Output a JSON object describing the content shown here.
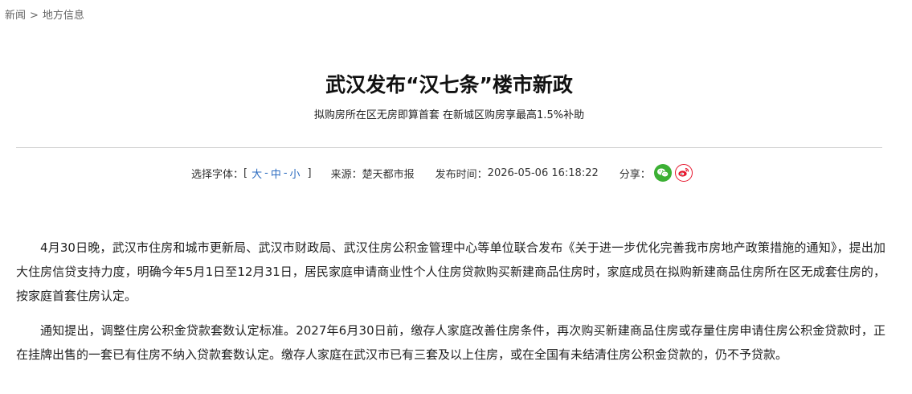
{
  "breadcrumb": {
    "items": [
      "新闻",
      "地方信息"
    ],
    "separator": ">"
  },
  "article": {
    "title": "武汉发布“汉七条”楼市新政",
    "subtitle": "拟购房所在区无房即算首套 在新城区购房享最高1.5%补助",
    "meta": {
      "font_label": "选择字体：",
      "bracket_open": "[",
      "font_large": "大",
      "font_medium": "中",
      "font_small": "小",
      "bracket_close": "]",
      "source_label": "来源：",
      "source": "楚天都市报",
      "time_label": "发布时间：",
      "time": "2026-05-06 16:18:22",
      "share_label": "分享：",
      "share_icons": [
        "wechat-icon",
        "weibo-icon"
      ]
    },
    "paragraphs": [
      "4月30日晚，武汉市住房和城市更新局、武汉市财政局、武汉住房公积金管理中心等单位联合发布《关于进一步优化完善我市房地产政策措施的通知》，提出加大住房信贷支持力度，明确今年5月1日至12月31日，居民家庭申请商业性个人住房贷款购买新建商品住房时，家庭成员在拟购新建商品住房所在区无成套住房的，按家庭首套住房认定。",
      "通知提出，调整住房公积金贷款套数认定标准。2027年6月30日前，缴存人家庭改善住房条件，再次购买新建商品住房或存量住房申请住房公积金贷款时，正在挂牌出售的一套已有住房不纳入贷款套数认定。缴存人家庭在武汉市已有三套及以上住房，或在全国有未结清住房公积金贷款的，仍不予贷款。"
    ]
  },
  "colors": {
    "link": "#2b6bc0",
    "wechat": "#3cb034",
    "weibo": "#e6162d",
    "divider": "#d6d6d6"
  }
}
